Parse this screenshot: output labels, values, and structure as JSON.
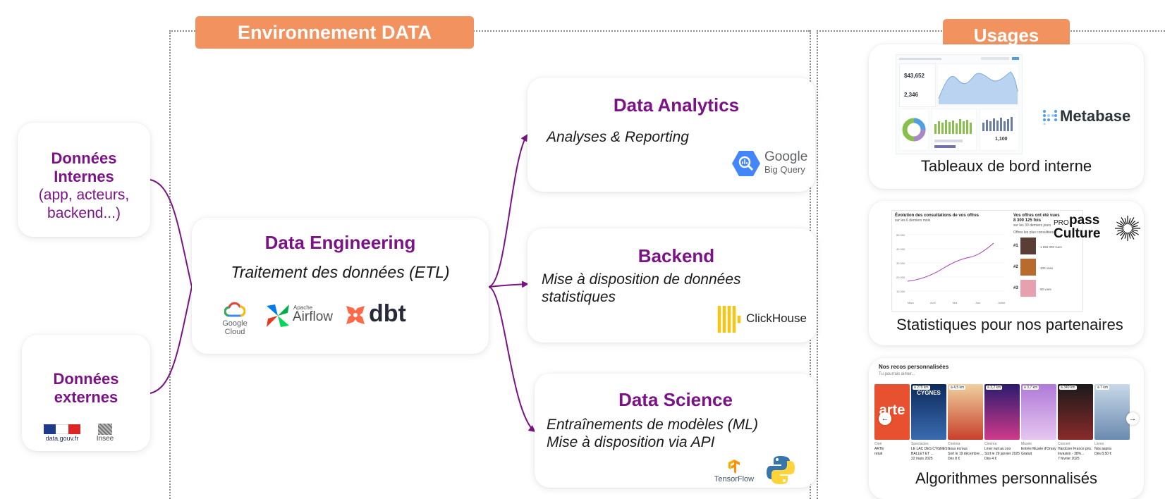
{
  "env_banner": "Environnement DATA",
  "usages_banner": "Usages",
  "sources": {
    "internal": {
      "title1": "Données",
      "title2": "Internes",
      "sub1": "(app, acteurs,",
      "sub2": "backend...)"
    },
    "external": {
      "title1": "Données",
      "title2": "externes",
      "logo1": "data.gouv.fr",
      "logo2": "Insee"
    }
  },
  "engineering": {
    "title": "Data Engineering",
    "subtitle": "Traitement des données (ETL)",
    "logos": {
      "gcloud": "Google Cloud",
      "airflow_small": "Apache",
      "airflow": "Airflow",
      "dbt": "dbt"
    }
  },
  "analytics": {
    "title": "Data Analytics",
    "subtitle": "Analyses & Reporting",
    "logo1": "Google",
    "logo2": "Big Query"
  },
  "backend": {
    "title": "Backend",
    "line1": "Mise à disposition de données",
    "line2": "statistiques",
    "logo": "ClickHouse"
  },
  "science": {
    "title": "Data Science",
    "line1": "Entraînements de modèles (ML)",
    "line2": "Mise à disposition via API",
    "logo": "TensorFlow"
  },
  "usages": {
    "dashboards": {
      "caption": "Tableaux de bord interne",
      "logo": "Metabase",
      "kpi1": "$43,652",
      "kpi2": "2,346",
      "kpi3": "1,100"
    },
    "partners": {
      "caption": "Statistiques pour nos partenaires",
      "chart_title": "Évolution des consultations de vos offres",
      "chart_sub": "sur les 6 derniers mois",
      "views_title": "Vos offres ont été vues",
      "views_count": "8 300 125 fois",
      "views_sub": "sur les 30 derniers jours",
      "top_label": "Offres les plus consultées",
      "brand_pro": "PRO",
      "brand1": "pass",
      "brand2": "Culture",
      "y_ticks": [
        "50 000",
        "40 000",
        "30 000",
        "20 000",
        "10 000"
      ],
      "x_ticks": [
        "Mars",
        "Avril",
        "Mai",
        "Juin",
        "Juillet"
      ],
      "ranks": [
        "#1",
        "#2",
        "#3"
      ],
      "offers": [
        "1 650 000 vues",
        "100 vues",
        "50 vues"
      ]
    },
    "algos": {
      "caption": "Algorithmes personnalisés",
      "header": "Nos recos personnalisées",
      "sub": "Tu pourrais aimer...",
      "posters": [
        {
          "badge": "",
          "cat": "Ciné",
          "l1": "ARTE",
          "l2": "retuit",
          "l3": ""
        },
        {
          "badge": "à 279 km",
          "cat": "Spectacles",
          "l1": "LE LAC DES CYGNES -",
          "l2": "BALLET ET ...",
          "l3": "22 mars 2025"
        },
        {
          "badge": "à 4,5 km",
          "cat": "Cinéma",
          "l1": "Sous écrous",
          "l2": "Sort le 19 décembre ...",
          "l3": "Dès 8 €"
        },
        {
          "badge": "à 3,2 km",
          "cat": "Cinéma",
          "l1": "Lmer nuit au zoo",
          "l2": "Sort le 29 janvier 2025",
          "l3": "Dès 4 €"
        },
        {
          "badge": "à 3,7 km",
          "cat": "Musée",
          "l1": "Entrée Musée d'Orsay",
          "l2": "Gratuit",
          "l3": ""
        },
        {
          "badge": "à 340 km",
          "cat": "Concert",
          "l1": "Hardcore France pris.",
          "l2": "Invasion - 38%...",
          "l3": "7 février 2025"
        },
        {
          "badge": "à 7 km",
          "cat": "Livres",
          "l1": "Nos aspira",
          "l2": "Dès 8,50 €",
          "l3": ""
        }
      ],
      "poster_texts": [
        "arte",
        "CYGNES",
        "",
        "",
        "",
        "",
        ""
      ]
    }
  }
}
